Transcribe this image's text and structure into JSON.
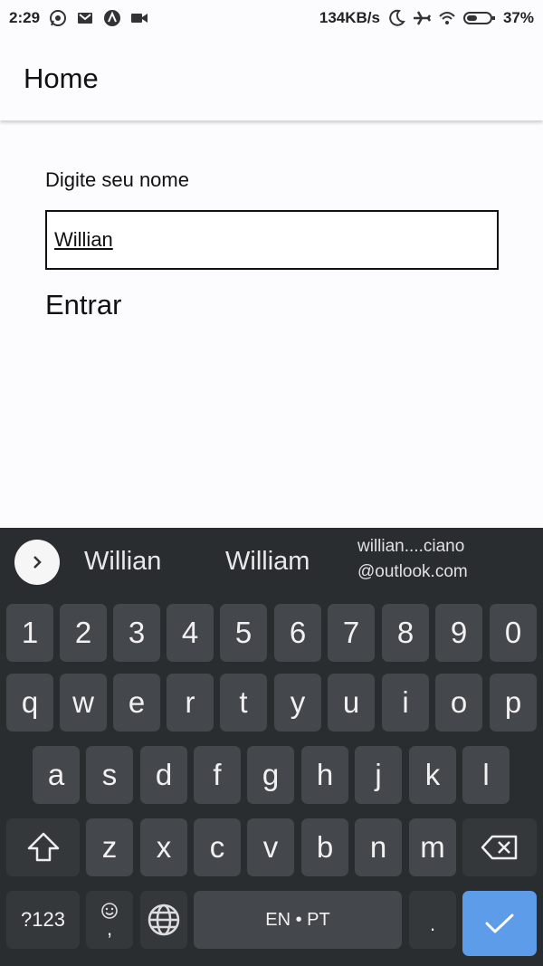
{
  "status_bar": {
    "time": "2:29",
    "net_speed": "134KB/s",
    "battery": "37%",
    "icons": [
      "whatsapp-icon",
      "gmail-icon",
      "app-icon",
      "video-icon",
      "moon-icon",
      "airplane-icon",
      "wifi-icon",
      "battery-icon"
    ]
  },
  "app_bar": {
    "title": "Home"
  },
  "form": {
    "label": "Digite seu nome",
    "input_value": "Willian",
    "button_label": "Entrar"
  },
  "keyboard": {
    "suggestions": [
      "Willian",
      "William"
    ],
    "email_suggestion": {
      "line1": "willian....ciano",
      "line2": "@outlook.com"
    },
    "row_numbers": [
      "1",
      "2",
      "3",
      "4",
      "5",
      "6",
      "7",
      "8",
      "9",
      "0"
    ],
    "row1": [
      "q",
      "w",
      "e",
      "r",
      "t",
      "y",
      "u",
      "i",
      "o",
      "p"
    ],
    "row2": [
      "a",
      "s",
      "d",
      "f",
      "g",
      "h",
      "j",
      "k",
      "l"
    ],
    "row3": [
      "z",
      "x",
      "c",
      "v",
      "b",
      "n",
      "m"
    ],
    "symbols_key": "?123",
    "emoji_comma_key": ",",
    "space_label": "EN • PT",
    "period_key": ".",
    "colors": {
      "background": "#2a2d30",
      "key": "#44474b",
      "enter": "#5c9ce8"
    }
  }
}
